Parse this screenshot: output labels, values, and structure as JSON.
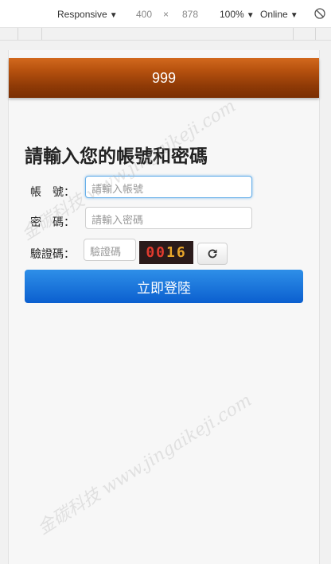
{
  "devtools": {
    "device": "Responsive",
    "width": "400",
    "times": "×",
    "height": "878",
    "zoom": "100%",
    "network": "Online"
  },
  "header": {
    "title": "999"
  },
  "form": {
    "heading": "請輸入您的帳號和密碼",
    "account_label": "帳　號：",
    "account_placeholder": "請輸入帳號",
    "password_label": "密　碼：",
    "password_placeholder": "請輸入密碼",
    "captcha_label": "驗證碼：",
    "captcha_placeholder": "驗證碼",
    "captcha_text": "0016",
    "login_button": "立即登陸"
  },
  "watermark": {
    "text": "金碳科技 www.jingaikeji.com"
  }
}
